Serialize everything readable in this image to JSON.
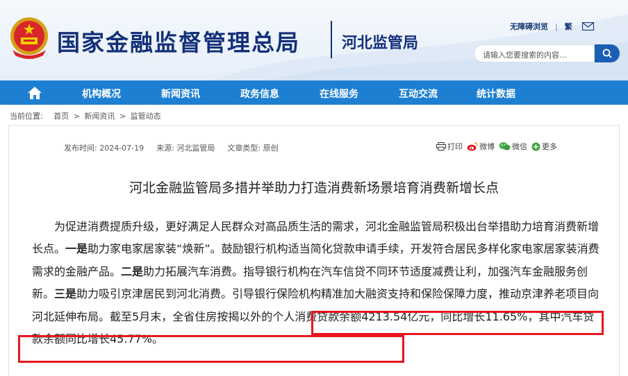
{
  "header": {
    "org_name": "国家金融监督管理总局",
    "branch_name": "河北监管局",
    "accessibility_link": "无障碍浏览",
    "traditional_link": "繁",
    "search_placeholder": "请输入您要搜索的内容…",
    "colors": {
      "brand": "#14307a",
      "nav_bg": "#1d7fd1",
      "highlight": "#e8141e"
    }
  },
  "nav": {
    "items": [
      "机构概况",
      "新闻资讯",
      "政务信息",
      "在线服务",
      "互动交流",
      "统计数据"
    ]
  },
  "breadcrumb": {
    "label": "当前位置:",
    "items": [
      "首页",
      "新闻资讯",
      "监管动态"
    ]
  },
  "article": {
    "meta": {
      "date_label": "发布时间:",
      "date": "2024-07-19",
      "source_label": "来源:",
      "source": "河北监管局",
      "type_label": "文章类型:",
      "type": "原创"
    },
    "share": {
      "print": "打印",
      "weibo": "微博",
      "wechat": "微信",
      "more": "更多"
    },
    "title": "河北金融监管局多措并举助力打造消费新场景培育消费新增长点",
    "para": {
      "p1": "为促进消费提质升级，更好满足人民群众对高品质生活的需求，河北金融监管局积极出台举措助力培育消费新增长点。",
      "b1": "一是",
      "p2": "助力家电家居家装“焕新”。鼓励银行机构适当简化贷款申请手续，开发符合居民多样化家电家居家装消费需求的金融产品。",
      "b2": "二是",
      "p3": "助力拓展汽车消费。指导银行机构在汽车信贷不同环节适度减费让利，加强汽车金融服务创新。",
      "b3": "三是",
      "p4": "助力吸引京津居民到河北消费。引导银行保险机构精准加大融资支持和保险保障力度，推动京津养老项目向河北延伸布局。",
      "p5": "截至5月末，全省住房按揭以外的个人消费贷款余额4213.54亿元，同比增长11.65%，其中汽车贷款余额同比增长45.77%。"
    }
  }
}
